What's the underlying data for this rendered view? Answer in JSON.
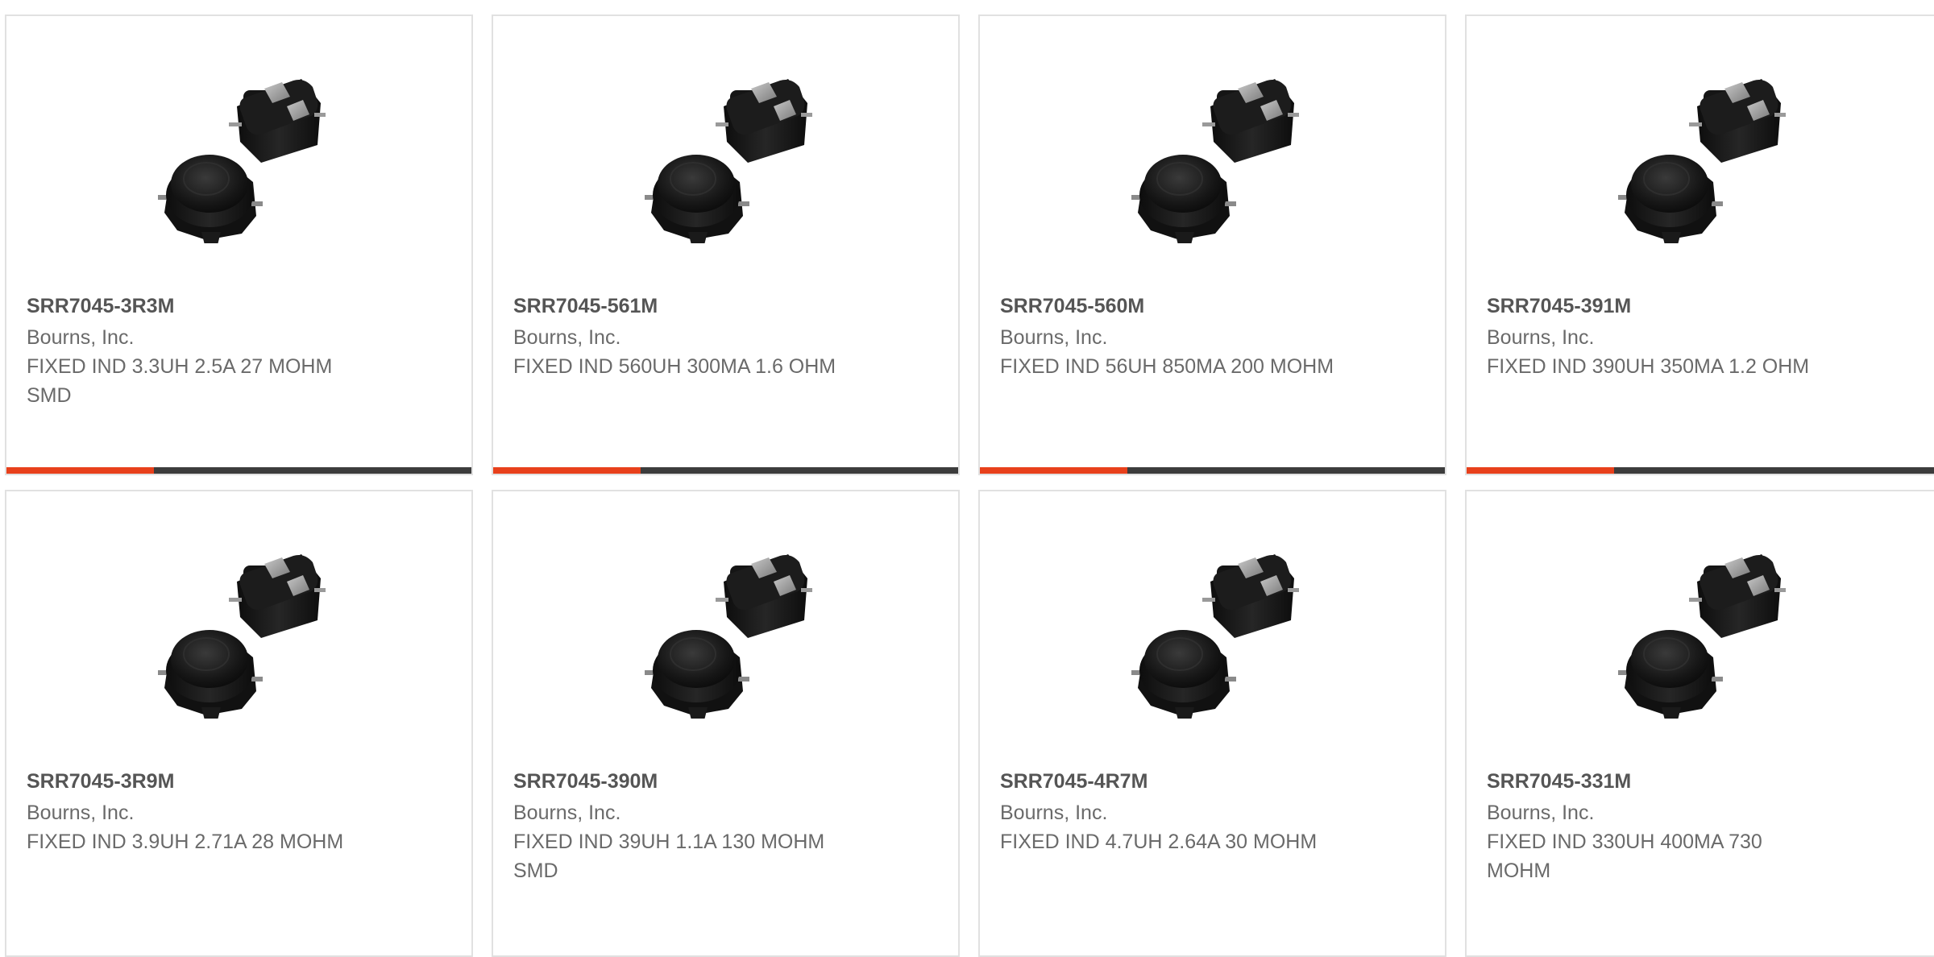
{
  "theme": {
    "accent": "#e8401b",
    "bar_dark": "#3c3c3c"
  },
  "products": [
    {
      "part_number": "SRR7045-3R3M",
      "manufacturer": "Bourns, Inc.",
      "description": "FIXED IND 3.3UH 2.5A 27 MOHM SMD",
      "image": "inductor-image"
    },
    {
      "part_number": "SRR7045-561M",
      "manufacturer": "Bourns, Inc.",
      "description": "FIXED IND 560UH 300MA 1.6 OHM",
      "image": "inductor-image"
    },
    {
      "part_number": "SRR7045-560M",
      "manufacturer": "Bourns, Inc.",
      "description": "FIXED IND 56UH 850MA 200 MOHM",
      "image": "inductor-image"
    },
    {
      "part_number": "SRR7045-391M",
      "manufacturer": "Bourns, Inc.",
      "description": "FIXED IND 390UH 350MA 1.2 OHM",
      "image": "inductor-image"
    },
    {
      "part_number": "SRR7045-3R9M",
      "manufacturer": "Bourns, Inc.",
      "description": "FIXED IND 3.9UH 2.71A 28 MOHM",
      "image": "inductor-image"
    },
    {
      "part_number": "SRR7045-390M",
      "manufacturer": "Bourns, Inc.",
      "description": "FIXED IND 39UH 1.1A 130 MOHM SMD",
      "image": "inductor-image"
    },
    {
      "part_number": "SRR7045-4R7M",
      "manufacturer": "Bourns, Inc.",
      "description": "FIXED IND 4.7UH 2.64A 30 MOHM",
      "image": "inductor-image"
    },
    {
      "part_number": "SRR7045-331M",
      "manufacturer": "Bourns, Inc.",
      "description": "FIXED IND 330UH 400MA 730 MOHM",
      "image": "inductor-image"
    }
  ]
}
